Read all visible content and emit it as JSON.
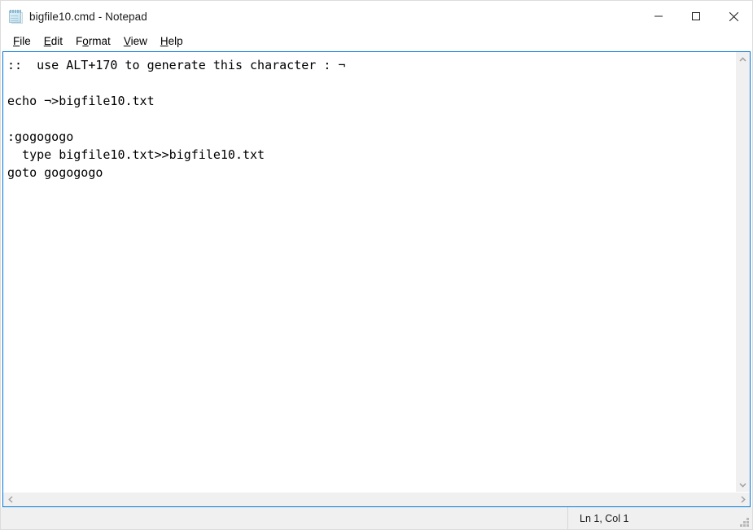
{
  "window": {
    "title": "bigfile10.cmd - Notepad",
    "icon": "notepad-icon",
    "accent_color": "#0078D7",
    "titlebar_bg": "#FFFFFF",
    "chrome_bg": "#F0F0F0"
  },
  "window_controls": {
    "minimize": "minimize-icon",
    "maximize": "maximize-icon",
    "close": "close-icon"
  },
  "menubar": {
    "items": [
      {
        "label": "File",
        "pre": "",
        "acc": "F",
        "post": "ile"
      },
      {
        "label": "Edit",
        "pre": "",
        "acc": "E",
        "post": "dit"
      },
      {
        "label": "Format",
        "pre": "F",
        "acc": "o",
        "post": "rmat"
      },
      {
        "label": "View",
        "pre": "",
        "acc": "V",
        "post": "iew"
      },
      {
        "label": "Help",
        "pre": "",
        "acc": "H",
        "post": "elp"
      }
    ]
  },
  "editor": {
    "content": "::  use ALT+170 to generate this character : ¬\n\necho ¬>bigfile10.txt\n\n:gogogogo\n  type bigfile10.txt>>bigfile10.txt\ngoto gogogogo",
    "lines": [
      "::  use ALT+170 to generate this character : ¬",
      "",
      "echo ¬>bigfile10.txt",
      "",
      ":gogogogo",
      "  type bigfile10.txt>>bigfile10.txt",
      "goto gogogogo"
    ]
  },
  "scrollbars": {
    "vertical": {
      "up": "chevron-up-icon",
      "down": "chevron-down-icon"
    },
    "horizontal": {
      "left": "chevron-left-icon",
      "right": "chevron-right-icon"
    }
  },
  "statusbar": {
    "position": "Ln 1, Col 1",
    "grip": "resize-grip-icon"
  }
}
